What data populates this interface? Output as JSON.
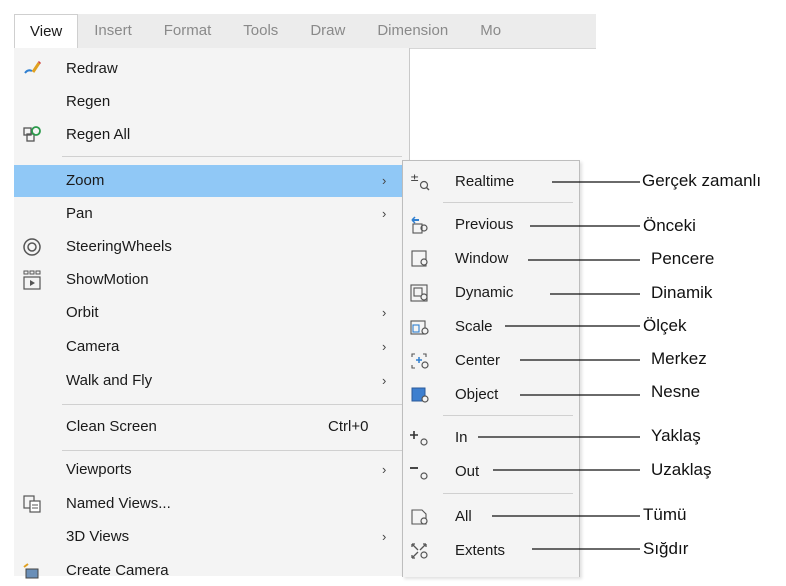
{
  "menubar": {
    "items": [
      "View",
      "Insert",
      "Format",
      "Tools",
      "Draw",
      "Dimension",
      "Mo"
    ]
  },
  "view_menu": {
    "items": [
      {
        "label": "Redraw",
        "icon": "redraw-icon"
      },
      {
        "label": "Regen",
        "icon": ""
      },
      {
        "label": "Regen All",
        "icon": "regen-all-icon"
      },
      {
        "label": "Zoom",
        "submenu": true,
        "highlighted": true
      },
      {
        "label": "Pan",
        "submenu": true
      },
      {
        "label": "SteeringWheels",
        "icon": "steeringwheels-icon"
      },
      {
        "label": "ShowMotion",
        "icon": "showmotion-icon"
      },
      {
        "label": "Orbit",
        "submenu": true
      },
      {
        "label": "Camera",
        "submenu": true
      },
      {
        "label": "Walk and Fly",
        "submenu": true
      },
      {
        "label": "Clean Screen",
        "shortcut": "Ctrl+0"
      },
      {
        "label": "Viewports",
        "submenu": true
      },
      {
        "label": "Named Views...",
        "icon": "named-views-icon"
      },
      {
        "label": "3D Views",
        "submenu": true
      },
      {
        "label": "Create Camera",
        "icon": "create-camera-icon"
      }
    ],
    "arrow": "›"
  },
  "zoom_menu": {
    "items": [
      {
        "label": "Realtime",
        "icon": "zoom-realtime-icon",
        "callout": "Gerçek zamanlı"
      },
      {
        "label": "Previous",
        "icon": "zoom-previous-icon",
        "callout": "Önceki"
      },
      {
        "label": "Window",
        "icon": "zoom-window-icon",
        "callout": "Pencere"
      },
      {
        "label": "Dynamic",
        "icon": "zoom-dynamic-icon",
        "callout": "Dinamik"
      },
      {
        "label": "Scale",
        "icon": "zoom-scale-icon",
        "callout": "Ölçek"
      },
      {
        "label": "Center",
        "icon": "zoom-center-icon",
        "callout": "Merkez"
      },
      {
        "label": "Object",
        "icon": "zoom-object-icon",
        "callout": "Nesne"
      },
      {
        "label": "In",
        "icon": "zoom-in-icon",
        "callout": "Yaklaş"
      },
      {
        "label": "Out",
        "icon": "zoom-out-icon",
        "callout": "Uzaklaş"
      },
      {
        "label": "All",
        "icon": "zoom-all-icon",
        "callout": "Tümü"
      },
      {
        "label": "Extents",
        "icon": "zoom-extents-icon",
        "callout": "Sığdır"
      }
    ]
  },
  "colors": {
    "highlight": "#90c8f6",
    "menu_bg": "#f4f4f4"
  }
}
